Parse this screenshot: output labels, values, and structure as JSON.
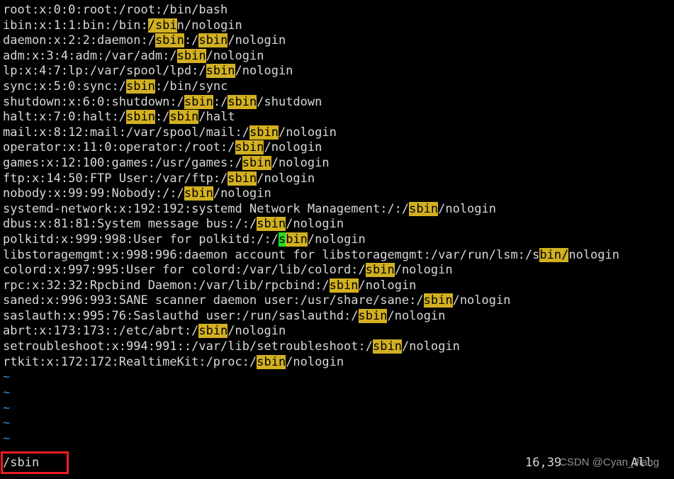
{
  "terminal": {
    "app": "vim",
    "background_color": "#000000",
    "foreground_color": "#d8d8d8",
    "search_highlight_color": "#d2b021",
    "cursor_color": "#22dd22",
    "tilde_color": "#2f8fd8",
    "annotation_box_color": "#ec1c24",
    "search_term": "sbin",
    "empty_line_marker": "~",
    "empty_line_count": 5
  },
  "lines": [
    {
      "text": "root:x:0:0:root:/root:/bin/bash",
      "highlights": []
    },
    {
      "text": "ibin:x:1:1:bin:/bin:/sbin/nologin",
      "highlights": [
        [
          20,
          24
        ]
      ]
    },
    {
      "text": "daemon:x:2:2:daemon:/sbin:/sbin/nologin",
      "highlights": [
        [
          21,
          25
        ],
        [
          27,
          31
        ]
      ]
    },
    {
      "text": "adm:x:3:4:adm:/var/adm:/sbin/nologin",
      "highlights": [
        [
          24,
          28
        ]
      ]
    },
    {
      "text": "lp:x:4:7:lp:/var/spool/lpd:/sbin/nologin",
      "highlights": [
        [
          28,
          32
        ]
      ]
    },
    {
      "text": "sync:x:5:0:sync:/sbin:/bin/sync",
      "highlights": [
        [
          17,
          21
        ]
      ]
    },
    {
      "text": "shutdown:x:6:0:shutdown:/sbin:/sbin/shutdown",
      "highlights": [
        [
          25,
          29
        ],
        [
          31,
          35
        ]
      ]
    },
    {
      "text": "halt:x:7:0:halt:/sbin:/sbin/halt",
      "highlights": [
        [
          17,
          21
        ],
        [
          23,
          27
        ]
      ]
    },
    {
      "text": "mail:x:8:12:mail:/var/spool/mail:/sbin/nologin",
      "highlights": [
        [
          34,
          38
        ]
      ]
    },
    {
      "text": "operator:x:11:0:operator:/root:/sbin/nologin",
      "highlights": [
        [
          32,
          36
        ]
      ]
    },
    {
      "text": "games:x:12:100:games:/usr/games:/sbin/nologin",
      "highlights": [
        [
          33,
          37
        ]
      ]
    },
    {
      "text": "ftp:x:14:50:FTP User:/var/ftp:/sbin/nologin",
      "highlights": [
        [
          31,
          35
        ]
      ]
    },
    {
      "text": "nobody:x:99:99:Nobody:/:/sbin/nologin",
      "highlights": [
        [
          25,
          29
        ]
      ]
    },
    {
      "text": "systemd-network:x:192:192:systemd Network Management:/:/sbin/nologin",
      "highlights": [
        [
          56,
          60
        ]
      ]
    },
    {
      "text": "dbus:x:81:81:System message bus:/:/sbin/nologin",
      "highlights": [
        [
          35,
          39
        ]
      ]
    },
    {
      "text": "polkitd:x:999:998:User for polkitd:/:/sbin/nologin",
      "highlights": [
        [
          38,
          42
        ]
      ],
      "cursor": 38
    },
    {
      "text": "libstoragemgmt:x:998:996:daemon account for libstoragemgmt:/var/run/lsm:/sbin/nologin",
      "highlights": [
        [
          74,
          78
        ]
      ]
    },
    {
      "text": "colord:x:997:995:User for colord:/var/lib/colord:/sbin/nologin",
      "highlights": [
        [
          50,
          54
        ]
      ]
    },
    {
      "text": "rpc:x:32:32:Rpcbind Daemon:/var/lib/rpcbind:/sbin/nologin",
      "highlights": [
        [
          45,
          49
        ]
      ]
    },
    {
      "text": "saned:x:996:993:SANE scanner daemon user:/usr/share/sane:/sbin/nologin",
      "highlights": [
        [
          58,
          62
        ]
      ]
    },
    {
      "text": "saslauth:x:995:76:Saslauthd user:/run/saslauthd:/sbin/nologin",
      "highlights": [
        [
          49,
          53
        ]
      ]
    },
    {
      "text": "abrt:x:173:173::/etc/abrt:/sbin/nologin",
      "highlights": [
        [
          27,
          31
        ]
      ]
    },
    {
      "text": "setroubleshoot:x:994:991::/var/lib/setroubleshoot:/sbin/nologin",
      "highlights": [
        [
          51,
          55
        ]
      ]
    },
    {
      "text": "rtkit:x:172:172:RealtimeKit:/proc:/sbin/nologin",
      "highlights": [
        [
          35,
          39
        ]
      ]
    }
  ],
  "command_line": {
    "text": "/sbin"
  },
  "ruler": {
    "position": "16,39",
    "scroll_percent": "All"
  },
  "watermark": {
    "text": "CSDN @Cyan_Jiang"
  }
}
